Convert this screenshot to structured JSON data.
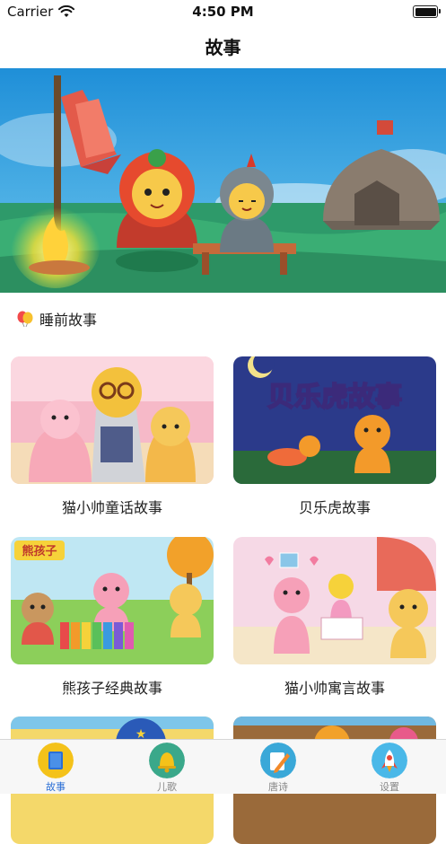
{
  "status_bar": {
    "carrier": "Carrier",
    "time": "4:50 PM"
  },
  "nav": {
    "title": "故事"
  },
  "section": {
    "label": "睡前故事"
  },
  "cards": [
    {
      "title": "猫小帅童话故事"
    },
    {
      "title": "贝乐虎故事",
      "art_text": "贝乐虎故事"
    },
    {
      "title": "熊孩子经典故事",
      "art_text": "熊孩子"
    },
    {
      "title": "猫小帅寓言故事"
    }
  ],
  "tabs": [
    {
      "label": "故事",
      "icon": "book-icon",
      "active": true
    },
    {
      "label": "儿歌",
      "icon": "bell-icon",
      "active": false
    },
    {
      "label": "唐诗",
      "icon": "pencil-icon",
      "active": false
    },
    {
      "label": "设置",
      "icon": "rocket-icon",
      "active": false
    }
  ],
  "colors": {
    "accent": "#2b6fd6",
    "tab_inactive": "#888888"
  }
}
